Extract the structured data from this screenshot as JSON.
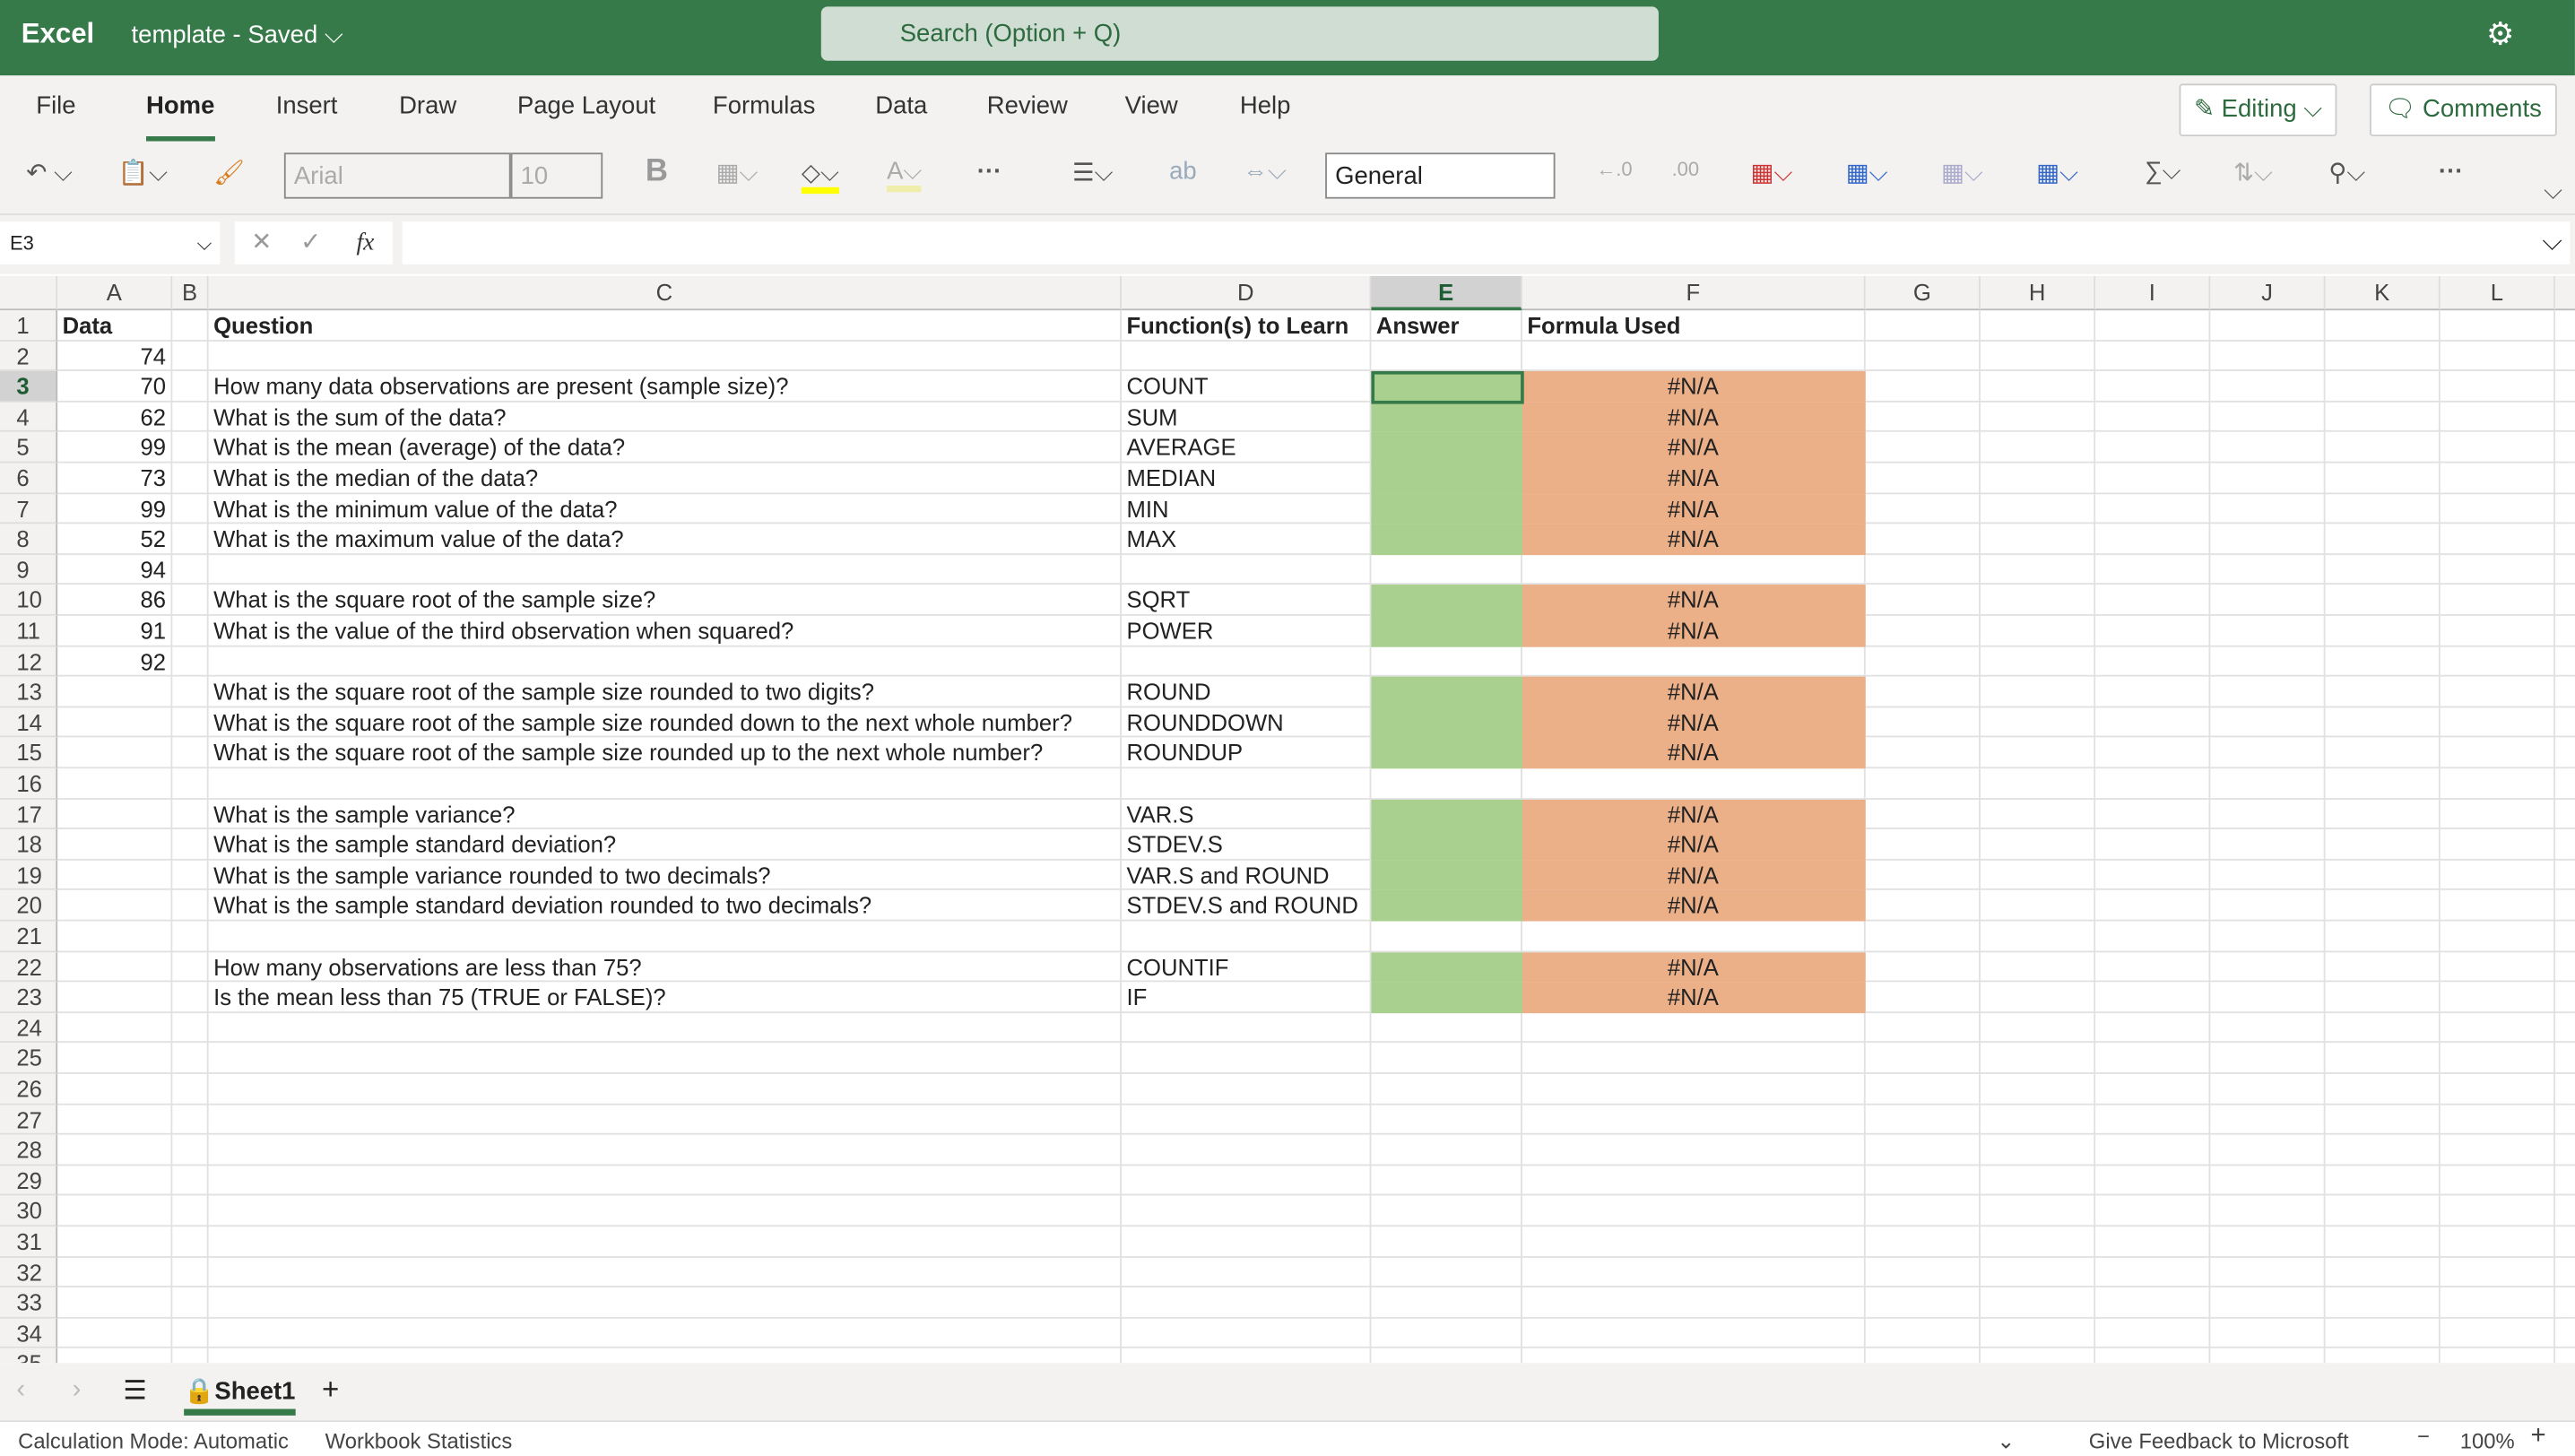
{
  "titlebar": {
    "app": "Excel",
    "doc": "template  -  Saved ⌵",
    "search_placeholder": "Search (Option + Q)"
  },
  "ribbon_tabs": [
    "File",
    "Home",
    "Insert",
    "Draw",
    "Page Layout",
    "Formulas",
    "Data",
    "Review",
    "View",
    "Help"
  ],
  "active_tab": "Home",
  "buttons": {
    "editing": "✎ Editing ⌵",
    "comments": "🗨 Comments"
  },
  "toolbar": {
    "font": "Arial",
    "size": "10",
    "number_format": "General",
    "bold": "B",
    "more": "···"
  },
  "formula_bar": {
    "name_box": "E3",
    "cancel": "✕",
    "enter": "✓",
    "fx": "fx",
    "value": ""
  },
  "columns": [
    "A",
    "B",
    "C",
    "D",
    "E",
    "F",
    "G",
    "H",
    "I",
    "J",
    "K",
    "L"
  ],
  "selected_cell": "E3",
  "colors": {
    "answer_fill": "#a9d08e",
    "formula_fill": "#ecb089",
    "brand": "#377a4a"
  },
  "header_row": {
    "A": "Data",
    "C": "Question",
    "D": "Function(s) to Learn",
    "E": "Answer",
    "F": "Formula Used"
  },
  "data_values": [
    74,
    70,
    62,
    99,
    73,
    99,
    52,
    94,
    86,
    91,
    92
  ],
  "questions": [
    {
      "row": 3,
      "q": "How many data observations are present (sample size)?",
      "fn": "COUNT",
      "f": "#N/A"
    },
    {
      "row": 4,
      "q": "What is the sum of the data?",
      "fn": "SUM",
      "f": "#N/A"
    },
    {
      "row": 5,
      "q": "What is the mean (average) of the data?",
      "fn": "AVERAGE",
      "f": "#N/A"
    },
    {
      "row": 6,
      "q": "What is the median of the data?",
      "fn": "MEDIAN",
      "f": "#N/A"
    },
    {
      "row": 7,
      "q": "What is the minimum value of the data?",
      "fn": "MIN",
      "f": "#N/A"
    },
    {
      "row": 8,
      "q": "What is the maximum value of the data?",
      "fn": "MAX",
      "f": "#N/A"
    },
    {
      "row": 10,
      "q": "What is the square root of the sample size?",
      "fn": "SQRT",
      "f": "#N/A"
    },
    {
      "row": 11,
      "q": "What is the value of the third observation when squared?",
      "fn": "POWER",
      "f": "#N/A"
    },
    {
      "row": 13,
      "q": "What is the square root of the sample size rounded to two digits?",
      "fn": "ROUND",
      "f": "#N/A"
    },
    {
      "row": 14,
      "q": "What is the square root of the sample size rounded down to the next whole number?",
      "fn": "ROUNDDOWN",
      "f": "#N/A"
    },
    {
      "row": 15,
      "q": "What is the square root of the sample size rounded up to the next whole number?",
      "fn": "ROUNDUP",
      "f": "#N/A"
    },
    {
      "row": 17,
      "q": "What is the sample variance?",
      "fn": "VAR.S",
      "f": "#N/A"
    },
    {
      "row": 18,
      "q": "What is the sample standard deviation?",
      "fn": "STDEV.S",
      "f": "#N/A"
    },
    {
      "row": 19,
      "q": "What is the sample variance rounded to two decimals?",
      "fn": "VAR.S and ROUND",
      "f": "#N/A"
    },
    {
      "row": 20,
      "q": "What is the sample standard deviation rounded to two decimals?",
      "fn": "STDEV.S and ROUND",
      "f": "#N/A"
    },
    {
      "row": 22,
      "q": "How many observations are less than 75?",
      "fn": "COUNTIF",
      "f": "#N/A"
    },
    {
      "row": 23,
      "q": "Is the mean less than 75 (TRUE or FALSE)?",
      "fn": "IF",
      "f": "#N/A"
    }
  ],
  "sheets": [
    "Sheet1"
  ],
  "status": {
    "calc": "Calculation Mode: Automatic",
    "stats": "Workbook Statistics",
    "feedback": "Give Feedback to Microsoft",
    "zoom": "100%"
  }
}
